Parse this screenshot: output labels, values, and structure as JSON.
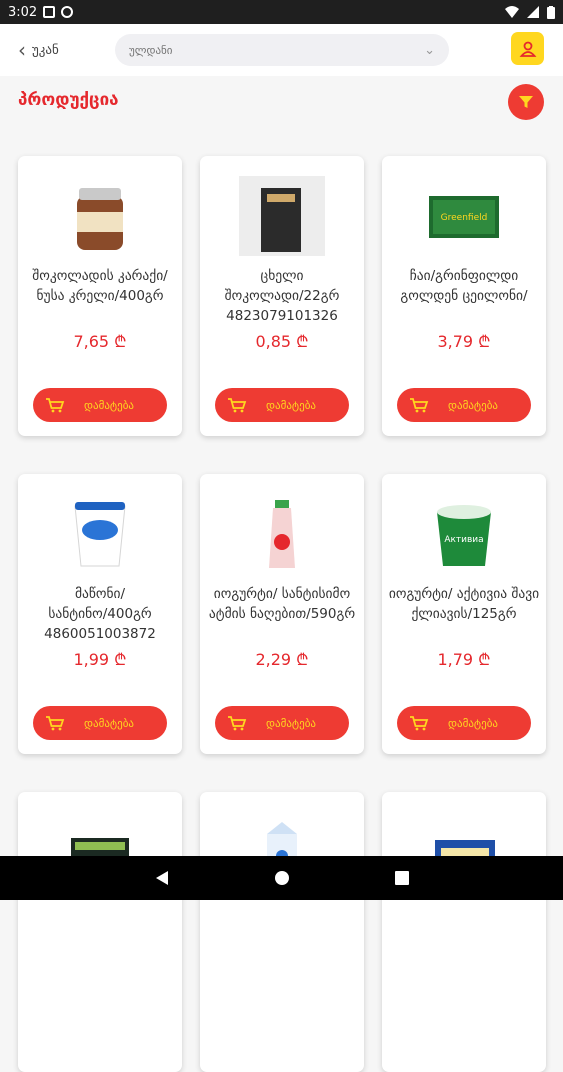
{
  "status": {
    "time": "3:02"
  },
  "header": {
    "back_label": "უკან",
    "search_placeholder": "ულდანი"
  },
  "page": {
    "title": "პროდუქცია"
  },
  "colors": {
    "accent": "#ee3b33",
    "yellow": "#ffd71f",
    "title": "#e5282d"
  },
  "products": [
    {
      "name": "შოკოლადის კარაქი/ნუსა კრელი/400გრ",
      "price": "7,65 ₾",
      "button": "დამატება",
      "image": "chocolate-spread-jar"
    },
    {
      "name": "ცხელი შოკოლადი/22გრ 4823079101326",
      "price": "0,85 ₾",
      "button": "დამატება",
      "image": "hot-chocolate-pack"
    },
    {
      "name": "ჩაი/გრინფილდი გოლდენ ცეილონი/",
      "price": "3,79 ₾",
      "button": "დამატება",
      "image": "tea-box"
    },
    {
      "name": "მაწონი/ სანტინო/400გრ 4860051003872",
      "price": "1,99 ₾",
      "button": "დამატება",
      "image": "yogurt-cup"
    },
    {
      "name": "იოგურტი/ სანტისიმო ატმის ნაღებით/590გრ",
      "price": "2,29 ₾",
      "button": "დამატება",
      "image": "drink-bottle"
    },
    {
      "name": "იოგურტი/ აქტივია შავი ქლიავის/125გრ",
      "price": "1,79 ₾",
      "button": "დამატება",
      "image": "activia-cup"
    },
    {
      "name": "",
      "price": "",
      "button": "",
      "image": "dark-box"
    },
    {
      "name": "",
      "price": "",
      "button": "",
      "image": "milk-carton"
    },
    {
      "name": "",
      "price": "",
      "button": "",
      "image": "butter-pack"
    }
  ]
}
